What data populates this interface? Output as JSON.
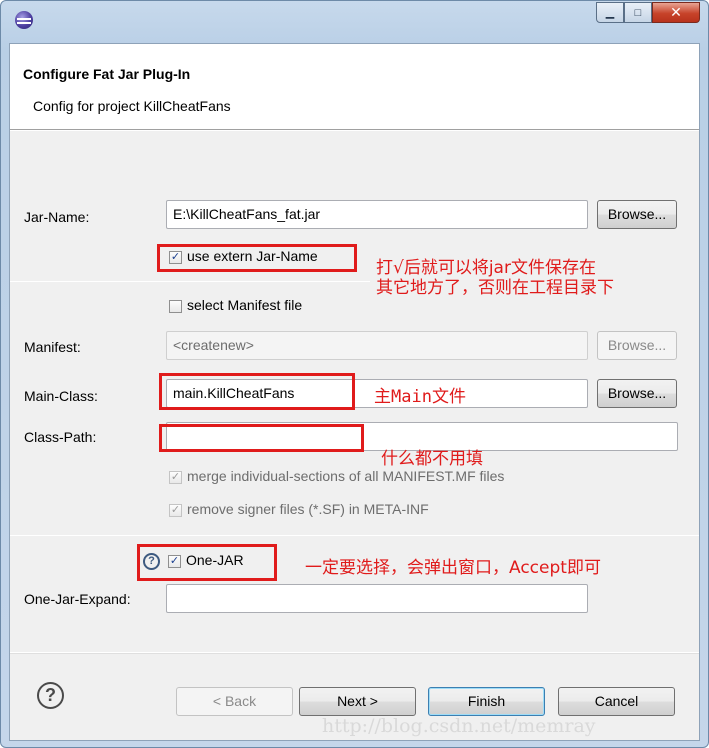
{
  "window": {
    "title": "",
    "minimize_glyph": "▁",
    "maximize_glyph": "□",
    "close_glyph": "✕"
  },
  "header": {
    "title": "Configure Fat Jar Plug-In",
    "subtitle": "Config for project KillCheatFans"
  },
  "form": {
    "jar_name_label": "Jar-Name:",
    "jar_name_value": "E:\\KillCheatFans_fat.jar",
    "browse_label": "Browse...",
    "use_extern_label": "use extern Jar-Name",
    "use_extern_checked": true,
    "select_manifest_label": "select Manifest file",
    "select_manifest_checked": false,
    "manifest_label": "Manifest:",
    "manifest_value": "<createnew>",
    "main_class_label": "Main-Class:",
    "main_class_value": "main.KillCheatFans",
    "class_path_label": "Class-Path:",
    "class_path_value": "",
    "merge_label": "merge individual-sections of all MANIFEST.MF files",
    "merge_checked": true,
    "remove_signer_label": "remove signer files (*.SF) in META-INF",
    "remove_signer_checked": true,
    "one_jar_label": "One-JAR",
    "one_jar_checked": true,
    "one_jar_expand_label": "One-Jar-Expand:",
    "one_jar_expand_value": ""
  },
  "annotations": {
    "extern_note_line1": "打√后就可以将jar文件保存在",
    "extern_note_line2": "其它地方了，否则在工程目录下",
    "main_note": "主Main文件",
    "classpath_note": "什么都不用填",
    "onejar_note": "一定要选择，会弹出窗口，Accept即可"
  },
  "footer": {
    "back_label": "< Back",
    "next_label": "Next >",
    "finish_label": "Finish",
    "cancel_label": "Cancel"
  },
  "watermark": "http://blog.csdn.net/memray",
  "colors": {
    "annotation_red": "#e01b1b",
    "window_frame": "#c7d9ec",
    "dialog_body": "#f0f0f0"
  },
  "icons": {
    "app": "eclipse-icon",
    "help": "help-icon",
    "check": "✓"
  }
}
